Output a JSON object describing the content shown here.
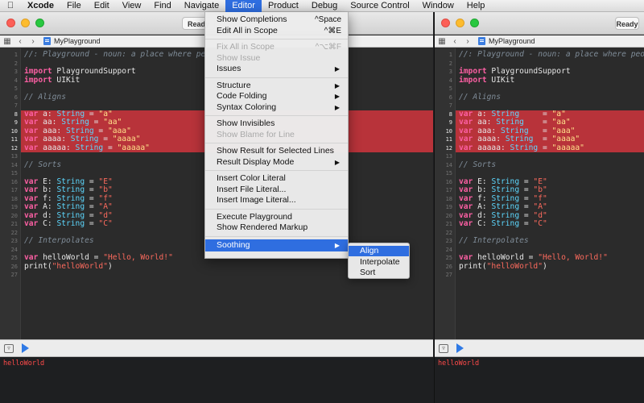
{
  "menubar": {
    "apple_icon": "apple-logo",
    "items": [
      "Xcode",
      "File",
      "Edit",
      "View",
      "Find",
      "Navigate",
      "Editor",
      "Product",
      "Debug",
      "Source Control",
      "Window",
      "Help"
    ],
    "active_item": "Editor"
  },
  "windows": [
    {
      "status": "Ready",
      "filename": "MyPlayground",
      "console_output": "helloWorld",
      "code": [
        [
          [
            "comment",
            "//: Playground - noun: a place where peo"
          ]
        ],
        [],
        [
          [
            "kw",
            "import"
          ],
          [
            "plain",
            " PlaygroundSupport"
          ]
        ],
        [
          [
            "kw",
            "import"
          ],
          [
            "plain",
            " UIKit"
          ]
        ],
        [],
        [
          [
            "comment",
            "// Aligns"
          ]
        ],
        [],
        [
          [
            "kw",
            "var"
          ],
          [
            "plain",
            " a: "
          ],
          [
            "type",
            "String"
          ],
          [
            "plain",
            " = "
          ],
          [
            "strsel",
            "\"a\""
          ]
        ],
        [
          [
            "kw",
            "var"
          ],
          [
            "plain",
            " aa: "
          ],
          [
            "type",
            "String"
          ],
          [
            "plain",
            " = "
          ],
          [
            "strsel",
            "\"aa\""
          ]
        ],
        [
          [
            "kw",
            "var"
          ],
          [
            "plain",
            " aaa: "
          ],
          [
            "type",
            "String"
          ],
          [
            "plain",
            " = "
          ],
          [
            "strsel",
            "\"aaa\""
          ]
        ],
        [
          [
            "kw",
            "var"
          ],
          [
            "plain",
            " aaaa: "
          ],
          [
            "type",
            "String"
          ],
          [
            "plain",
            " = "
          ],
          [
            "strsel",
            "\"aaaa\""
          ]
        ],
        [
          [
            "kw",
            "var"
          ],
          [
            "plain",
            " aaaaa: "
          ],
          [
            "type",
            "String"
          ],
          [
            "plain",
            " = "
          ],
          [
            "strsel",
            "\"aaaaa\""
          ]
        ],
        [],
        [
          [
            "comment",
            "// Sorts"
          ]
        ],
        [],
        [
          [
            "kw",
            "var"
          ],
          [
            "plain",
            " E: "
          ],
          [
            "type",
            "String"
          ],
          [
            "plain",
            " = "
          ],
          [
            "str",
            "\"E\""
          ]
        ],
        [
          [
            "kw",
            "var"
          ],
          [
            "plain",
            " b: "
          ],
          [
            "type",
            "String"
          ],
          [
            "plain",
            " = "
          ],
          [
            "str",
            "\"b\""
          ]
        ],
        [
          [
            "kw",
            "var"
          ],
          [
            "plain",
            " f: "
          ],
          [
            "type",
            "String"
          ],
          [
            "plain",
            " = "
          ],
          [
            "str",
            "\"f\""
          ]
        ],
        [
          [
            "kw",
            "var"
          ],
          [
            "plain",
            " A: "
          ],
          [
            "type",
            "String"
          ],
          [
            "plain",
            " = "
          ],
          [
            "str",
            "\"A\""
          ]
        ],
        [
          [
            "kw",
            "var"
          ],
          [
            "plain",
            " d: "
          ],
          [
            "type",
            "String"
          ],
          [
            "plain",
            " = "
          ],
          [
            "str",
            "\"d\""
          ]
        ],
        [
          [
            "kw",
            "var"
          ],
          [
            "plain",
            " C: "
          ],
          [
            "type",
            "String"
          ],
          [
            "plain",
            " = "
          ],
          [
            "str",
            "\"C\""
          ]
        ],
        [],
        [
          [
            "comment",
            "// Interpolates"
          ]
        ],
        [],
        [
          [
            "kw",
            "var"
          ],
          [
            "plain",
            " helloWorld = "
          ],
          [
            "str",
            "\"Hello, World!\""
          ]
        ],
        [
          [
            "plain",
            "print("
          ],
          [
            "str",
            "\"helloWorld\""
          ],
          [
            "plain",
            ")"
          ]
        ],
        []
      ],
      "highlight_lines": [
        8,
        9,
        10,
        11,
        12
      ]
    },
    {
      "status": "Ready",
      "filename": "MyPlayground",
      "console_output": "helloWorld",
      "code": [
        [
          [
            "comment",
            "//: Playground - noun: a place where peo"
          ]
        ],
        [],
        [
          [
            "kw",
            "import"
          ],
          [
            "plain",
            " PlaygroundSupport"
          ]
        ],
        [
          [
            "kw",
            "import"
          ],
          [
            "plain",
            " UIKit"
          ]
        ],
        [],
        [
          [
            "comment",
            "// Aligns"
          ]
        ],
        [],
        [
          [
            "kw",
            "var"
          ],
          [
            "plain",
            " a: "
          ],
          [
            "type",
            "String"
          ],
          [
            "plain",
            "     = "
          ],
          [
            "strsel",
            "\"a\""
          ]
        ],
        [
          [
            "kw",
            "var"
          ],
          [
            "plain",
            " aa: "
          ],
          [
            "type",
            "String"
          ],
          [
            "plain",
            "    = "
          ],
          [
            "strsel",
            "\"aa\""
          ]
        ],
        [
          [
            "kw",
            "var"
          ],
          [
            "plain",
            " aaa: "
          ],
          [
            "type",
            "String"
          ],
          [
            "plain",
            "   = "
          ],
          [
            "strsel",
            "\"aaa\""
          ]
        ],
        [
          [
            "kw",
            "var"
          ],
          [
            "plain",
            " aaaa: "
          ],
          [
            "type",
            "String"
          ],
          [
            "plain",
            "  = "
          ],
          [
            "strsel",
            "\"aaaa\""
          ]
        ],
        [
          [
            "kw",
            "var"
          ],
          [
            "plain",
            " aaaaa: "
          ],
          [
            "type",
            "String"
          ],
          [
            "plain",
            " = "
          ],
          [
            "strsel",
            "\"aaaaa\""
          ]
        ],
        [],
        [
          [
            "comment",
            "// Sorts"
          ]
        ],
        [],
        [
          [
            "kw",
            "var"
          ],
          [
            "plain",
            " E: "
          ],
          [
            "type",
            "String"
          ],
          [
            "plain",
            " = "
          ],
          [
            "str",
            "\"E\""
          ]
        ],
        [
          [
            "kw",
            "var"
          ],
          [
            "plain",
            " b: "
          ],
          [
            "type",
            "String"
          ],
          [
            "plain",
            " = "
          ],
          [
            "str",
            "\"b\""
          ]
        ],
        [
          [
            "kw",
            "var"
          ],
          [
            "plain",
            " f: "
          ],
          [
            "type",
            "String"
          ],
          [
            "plain",
            " = "
          ],
          [
            "str",
            "\"f\""
          ]
        ],
        [
          [
            "kw",
            "var"
          ],
          [
            "plain",
            " A: "
          ],
          [
            "type",
            "String"
          ],
          [
            "plain",
            " = "
          ],
          [
            "str",
            "\"A\""
          ]
        ],
        [
          [
            "kw",
            "var"
          ],
          [
            "plain",
            " d: "
          ],
          [
            "type",
            "String"
          ],
          [
            "plain",
            " = "
          ],
          [
            "str",
            "\"d\""
          ]
        ],
        [
          [
            "kw",
            "var"
          ],
          [
            "plain",
            " C: "
          ],
          [
            "type",
            "String"
          ],
          [
            "plain",
            " = "
          ],
          [
            "str",
            "\"C\""
          ]
        ],
        [],
        [
          [
            "comment",
            "// Interpolates"
          ]
        ],
        [],
        [
          [
            "kw",
            "var"
          ],
          [
            "plain",
            " helloWorld = "
          ],
          [
            "str",
            "\"Hello, World!\""
          ]
        ],
        [
          [
            "plain",
            "print("
          ],
          [
            "str",
            "\"helloWorld\""
          ],
          [
            "plain",
            ")"
          ]
        ],
        []
      ],
      "highlight_lines": [
        8,
        9,
        10,
        11,
        12
      ]
    }
  ],
  "editor_menu": {
    "items": [
      {
        "label": "Show Completions",
        "shortcut": "^Space"
      },
      {
        "label": "Edit All in Scope",
        "shortcut": "^⌘E"
      },
      {
        "separator": true
      },
      {
        "label": "Fix All in Scope",
        "shortcut": "^⌥⌘F",
        "disabled": true
      },
      {
        "label": "Show Issue",
        "disabled": true
      },
      {
        "label": "Issues",
        "submenu": true
      },
      {
        "separator": true
      },
      {
        "label": "Structure",
        "submenu": true
      },
      {
        "label": "Code Folding",
        "submenu": true
      },
      {
        "label": "Syntax Coloring",
        "submenu": true
      },
      {
        "separator": true
      },
      {
        "label": "Show Invisibles"
      },
      {
        "label": "Show Blame for Line",
        "disabled": true
      },
      {
        "separator": true
      },
      {
        "label": "Show Result for Selected Lines"
      },
      {
        "label": "Result Display Mode",
        "submenu": true
      },
      {
        "separator": true
      },
      {
        "label": "Insert Color Literal"
      },
      {
        "label": "Insert File Literal..."
      },
      {
        "label": "Insert Image Literal..."
      },
      {
        "separator": true
      },
      {
        "label": "Execute Playground"
      },
      {
        "label": "Show Rendered Markup"
      },
      {
        "separator": true
      },
      {
        "label": "Soothing",
        "submenu": true,
        "selected": true
      }
    ]
  },
  "soothing_submenu": {
    "items": [
      {
        "label": "Align",
        "selected": true
      },
      {
        "label": "Interpolate"
      },
      {
        "label": "Sort"
      }
    ]
  },
  "colors": {
    "selection_band": "#b8333a",
    "menu_highlight": "#2f6ee0",
    "keyword": "#fc5fa3",
    "type": "#5dd8ff",
    "string": "#fc6a5d",
    "comment": "#7f8c98",
    "console_text": "#ff4a4a"
  }
}
